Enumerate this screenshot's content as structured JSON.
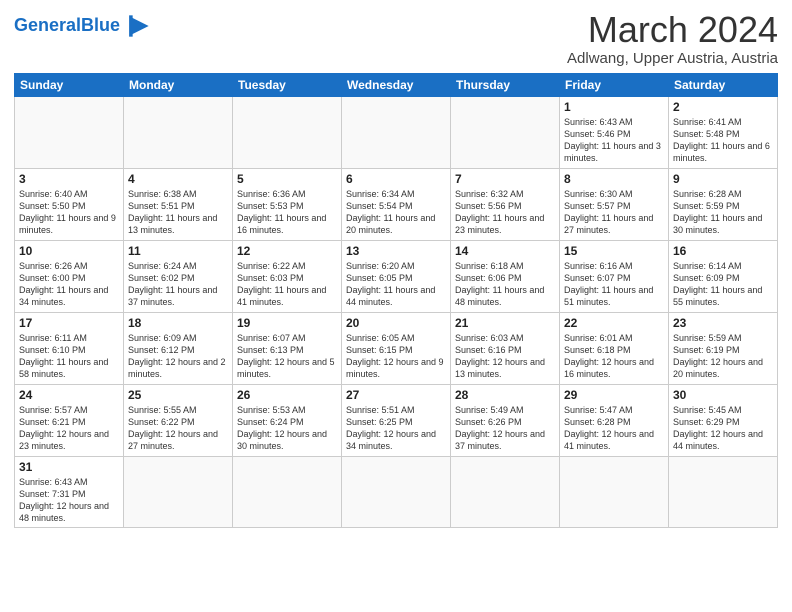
{
  "header": {
    "logo_text_normal": "General",
    "logo_text_colored": "Blue",
    "month_year": "March 2024",
    "location": "Adlwang, Upper Austria, Austria"
  },
  "days_of_week": [
    "Sunday",
    "Monday",
    "Tuesday",
    "Wednesday",
    "Thursday",
    "Friday",
    "Saturday"
  ],
  "weeks": [
    [
      {
        "day": "",
        "info": ""
      },
      {
        "day": "",
        "info": ""
      },
      {
        "day": "",
        "info": ""
      },
      {
        "day": "",
        "info": ""
      },
      {
        "day": "",
        "info": ""
      },
      {
        "day": "1",
        "info": "Sunrise: 6:43 AM\nSunset: 5:46 PM\nDaylight: 11 hours and 3 minutes."
      },
      {
        "day": "2",
        "info": "Sunrise: 6:41 AM\nSunset: 5:48 PM\nDaylight: 11 hours and 6 minutes."
      }
    ],
    [
      {
        "day": "3",
        "info": "Sunrise: 6:40 AM\nSunset: 5:50 PM\nDaylight: 11 hours and 9 minutes."
      },
      {
        "day": "4",
        "info": "Sunrise: 6:38 AM\nSunset: 5:51 PM\nDaylight: 11 hours and 13 minutes."
      },
      {
        "day": "5",
        "info": "Sunrise: 6:36 AM\nSunset: 5:53 PM\nDaylight: 11 hours and 16 minutes."
      },
      {
        "day": "6",
        "info": "Sunrise: 6:34 AM\nSunset: 5:54 PM\nDaylight: 11 hours and 20 minutes."
      },
      {
        "day": "7",
        "info": "Sunrise: 6:32 AM\nSunset: 5:56 PM\nDaylight: 11 hours and 23 minutes."
      },
      {
        "day": "8",
        "info": "Sunrise: 6:30 AM\nSunset: 5:57 PM\nDaylight: 11 hours and 27 minutes."
      },
      {
        "day": "9",
        "info": "Sunrise: 6:28 AM\nSunset: 5:59 PM\nDaylight: 11 hours and 30 minutes."
      }
    ],
    [
      {
        "day": "10",
        "info": "Sunrise: 6:26 AM\nSunset: 6:00 PM\nDaylight: 11 hours and 34 minutes."
      },
      {
        "day": "11",
        "info": "Sunrise: 6:24 AM\nSunset: 6:02 PM\nDaylight: 11 hours and 37 minutes."
      },
      {
        "day": "12",
        "info": "Sunrise: 6:22 AM\nSunset: 6:03 PM\nDaylight: 11 hours and 41 minutes."
      },
      {
        "day": "13",
        "info": "Sunrise: 6:20 AM\nSunset: 6:05 PM\nDaylight: 11 hours and 44 minutes."
      },
      {
        "day": "14",
        "info": "Sunrise: 6:18 AM\nSunset: 6:06 PM\nDaylight: 11 hours and 48 minutes."
      },
      {
        "day": "15",
        "info": "Sunrise: 6:16 AM\nSunset: 6:07 PM\nDaylight: 11 hours and 51 minutes."
      },
      {
        "day": "16",
        "info": "Sunrise: 6:14 AM\nSunset: 6:09 PM\nDaylight: 11 hours and 55 minutes."
      }
    ],
    [
      {
        "day": "17",
        "info": "Sunrise: 6:11 AM\nSunset: 6:10 PM\nDaylight: 11 hours and 58 minutes."
      },
      {
        "day": "18",
        "info": "Sunrise: 6:09 AM\nSunset: 6:12 PM\nDaylight: 12 hours and 2 minutes."
      },
      {
        "day": "19",
        "info": "Sunrise: 6:07 AM\nSunset: 6:13 PM\nDaylight: 12 hours and 5 minutes."
      },
      {
        "day": "20",
        "info": "Sunrise: 6:05 AM\nSunset: 6:15 PM\nDaylight: 12 hours and 9 minutes."
      },
      {
        "day": "21",
        "info": "Sunrise: 6:03 AM\nSunset: 6:16 PM\nDaylight: 12 hours and 13 minutes."
      },
      {
        "day": "22",
        "info": "Sunrise: 6:01 AM\nSunset: 6:18 PM\nDaylight: 12 hours and 16 minutes."
      },
      {
        "day": "23",
        "info": "Sunrise: 5:59 AM\nSunset: 6:19 PM\nDaylight: 12 hours and 20 minutes."
      }
    ],
    [
      {
        "day": "24",
        "info": "Sunrise: 5:57 AM\nSunset: 6:21 PM\nDaylight: 12 hours and 23 minutes."
      },
      {
        "day": "25",
        "info": "Sunrise: 5:55 AM\nSunset: 6:22 PM\nDaylight: 12 hours and 27 minutes."
      },
      {
        "day": "26",
        "info": "Sunrise: 5:53 AM\nSunset: 6:24 PM\nDaylight: 12 hours and 30 minutes."
      },
      {
        "day": "27",
        "info": "Sunrise: 5:51 AM\nSunset: 6:25 PM\nDaylight: 12 hours and 34 minutes."
      },
      {
        "day": "28",
        "info": "Sunrise: 5:49 AM\nSunset: 6:26 PM\nDaylight: 12 hours and 37 minutes."
      },
      {
        "day": "29",
        "info": "Sunrise: 5:47 AM\nSunset: 6:28 PM\nDaylight: 12 hours and 41 minutes."
      },
      {
        "day": "30",
        "info": "Sunrise: 5:45 AM\nSunset: 6:29 PM\nDaylight: 12 hours and 44 minutes."
      }
    ],
    [
      {
        "day": "31",
        "info": "Sunrise: 6:43 AM\nSunset: 7:31 PM\nDaylight: 12 hours and 48 minutes."
      },
      {
        "day": "",
        "info": ""
      },
      {
        "day": "",
        "info": ""
      },
      {
        "day": "",
        "info": ""
      },
      {
        "day": "",
        "info": ""
      },
      {
        "day": "",
        "info": ""
      },
      {
        "day": "",
        "info": ""
      }
    ]
  ]
}
